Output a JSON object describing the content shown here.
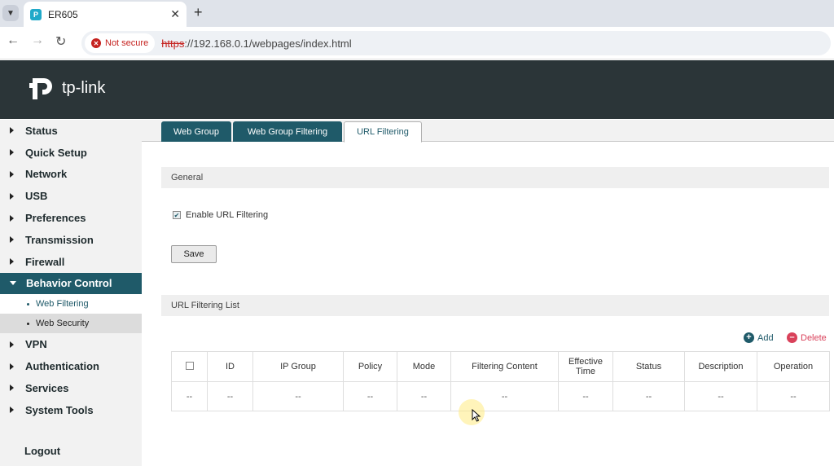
{
  "browser": {
    "tab_title": "ER605",
    "favicon_text": "P",
    "not_secure_label": "Not secure",
    "url_scheme": "https",
    "url_rest": "://192.168.0.1/webpages/index.html"
  },
  "brand": {
    "logo_text": "tp-link",
    "color": "#2b3538"
  },
  "sidebar": {
    "items": [
      {
        "label": "Status"
      },
      {
        "label": "Quick Setup"
      },
      {
        "label": "Network"
      },
      {
        "label": "USB"
      },
      {
        "label": "Preferences"
      },
      {
        "label": "Transmission"
      },
      {
        "label": "Firewall"
      },
      {
        "label": "Behavior Control"
      },
      {
        "label": "VPN"
      },
      {
        "label": "Authentication"
      },
      {
        "label": "Services"
      },
      {
        "label": "System Tools"
      }
    ],
    "sub_items": [
      {
        "label": "Web Filtering"
      },
      {
        "label": "Web Security"
      }
    ],
    "logout_label": "Logout"
  },
  "tabs": [
    {
      "label": "Web Group"
    },
    {
      "label": "Web Group Filtering"
    },
    {
      "label": "URL Filtering"
    }
  ],
  "general": {
    "title": "General",
    "enable_label": "Enable URL Filtering",
    "enabled": true,
    "save_label": "Save"
  },
  "list": {
    "title": "URL Filtering List",
    "add_label": "Add",
    "delete_label": "Delete",
    "columns": {
      "id": "ID",
      "ip_group": "IP Group",
      "policy": "Policy",
      "mode": "Mode",
      "filtering_content": "Filtering Content",
      "effective_time_1": "Effective",
      "effective_time_2": "Time",
      "status": "Status",
      "description": "Description",
      "operation": "Operation"
    },
    "empty_row": [
      "--",
      "--",
      "--",
      "--",
      "--",
      "--",
      "--",
      "--",
      "--",
      "--"
    ]
  },
  "colors": {
    "accent": "#1f5a69",
    "add": "#1f5a69",
    "delete": "#d9415a"
  }
}
